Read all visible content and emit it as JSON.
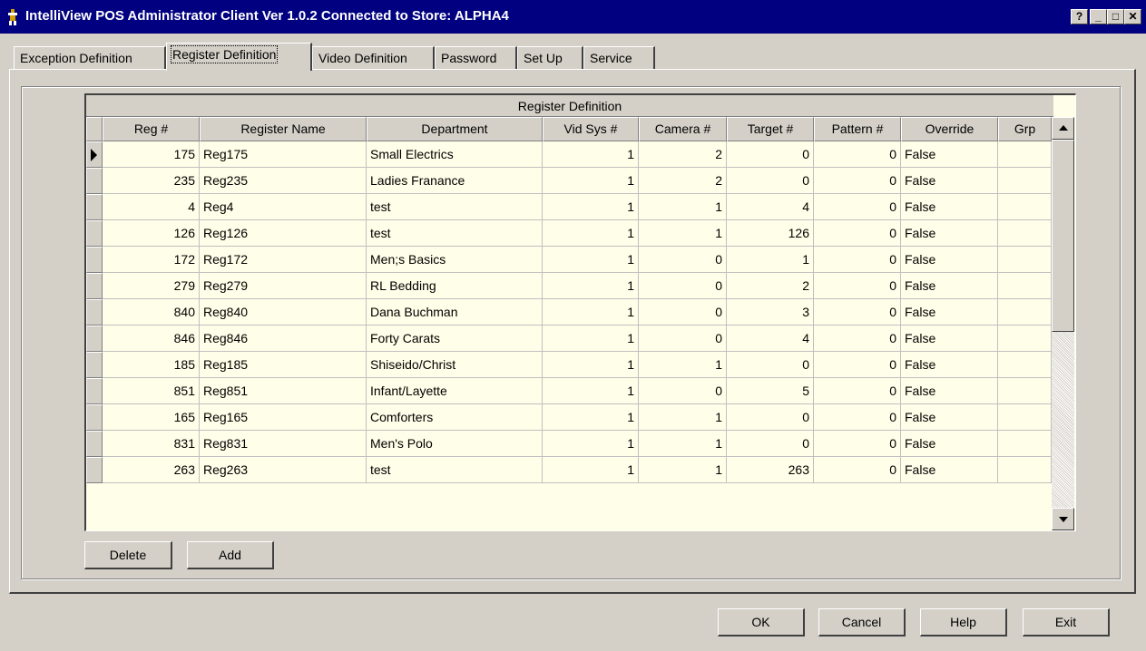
{
  "window": {
    "title": "IntelliView POS Administrator Client  Ver 1.0.2 Connected to Store: ALPHA4"
  },
  "titlebar_buttons": {
    "help": "?",
    "minimize": "_",
    "maximize": "□",
    "close": "✕"
  },
  "tabs": [
    {
      "label": "Exception Definition",
      "active": false
    },
    {
      "label": "Register Definition",
      "active": true
    },
    {
      "label": "Video Definition",
      "active": false
    },
    {
      "label": "Password",
      "active": false
    },
    {
      "label": "Set Up",
      "active": false
    },
    {
      "label": "Service",
      "active": false
    }
  ],
  "grid": {
    "caption": "Register Definition",
    "columns": [
      "Reg #",
      "Register Name",
      "Department",
      "Vid Sys #",
      "Camera #",
      "Target #",
      "Pattern #",
      "Override",
      "Grp"
    ],
    "rows": [
      [
        "175",
        "Reg175",
        "Small Electrics",
        "1",
        "2",
        "0",
        "0",
        "False",
        ""
      ],
      [
        "235",
        "Reg235",
        "Ladies Franance",
        "1",
        "2",
        "0",
        "0",
        "False",
        ""
      ],
      [
        "4",
        "Reg4",
        "test",
        "1",
        "1",
        "4",
        "0",
        "False",
        ""
      ],
      [
        "126",
        "Reg126",
        "test",
        "1",
        "1",
        "126",
        "0",
        "False",
        ""
      ],
      [
        "172",
        "Reg172",
        "Men;s Basics",
        "1",
        "0",
        "1",
        "0",
        "False",
        ""
      ],
      [
        "279",
        "Reg279",
        "RL Bedding",
        "1",
        "0",
        "2",
        "0",
        "False",
        ""
      ],
      [
        "840",
        "Reg840",
        "Dana Buchman",
        "1",
        "0",
        "3",
        "0",
        "False",
        ""
      ],
      [
        "846",
        "Reg846",
        "Forty Carats",
        "1",
        "0",
        "4",
        "0",
        "False",
        ""
      ],
      [
        "185",
        "Reg185",
        "Shiseido/Christ",
        "1",
        "1",
        "0",
        "0",
        "False",
        ""
      ],
      [
        "851",
        "Reg851",
        "Infant/Layette",
        "1",
        "0",
        "5",
        "0",
        "False",
        ""
      ],
      [
        "165",
        "Reg165",
        "Comforters",
        "1",
        "1",
        "0",
        "0",
        "False",
        ""
      ],
      [
        "831",
        "Reg831",
        "Men's Polo",
        "1",
        "1",
        "0",
        "0",
        "False",
        ""
      ],
      [
        "263",
        "Reg263",
        "test",
        "1",
        "1",
        "263",
        "0",
        "False",
        ""
      ]
    ],
    "current_row": 0
  },
  "grid_buttons": {
    "delete": "Delete",
    "add": "Add"
  },
  "dialog_buttons": {
    "ok": "OK",
    "cancel": "Cancel",
    "help": "Help",
    "exit": "Exit"
  },
  "colors": {
    "title_bg": "#000080",
    "grid_bg": "#fffee8",
    "face": "#d4d0c8"
  }
}
